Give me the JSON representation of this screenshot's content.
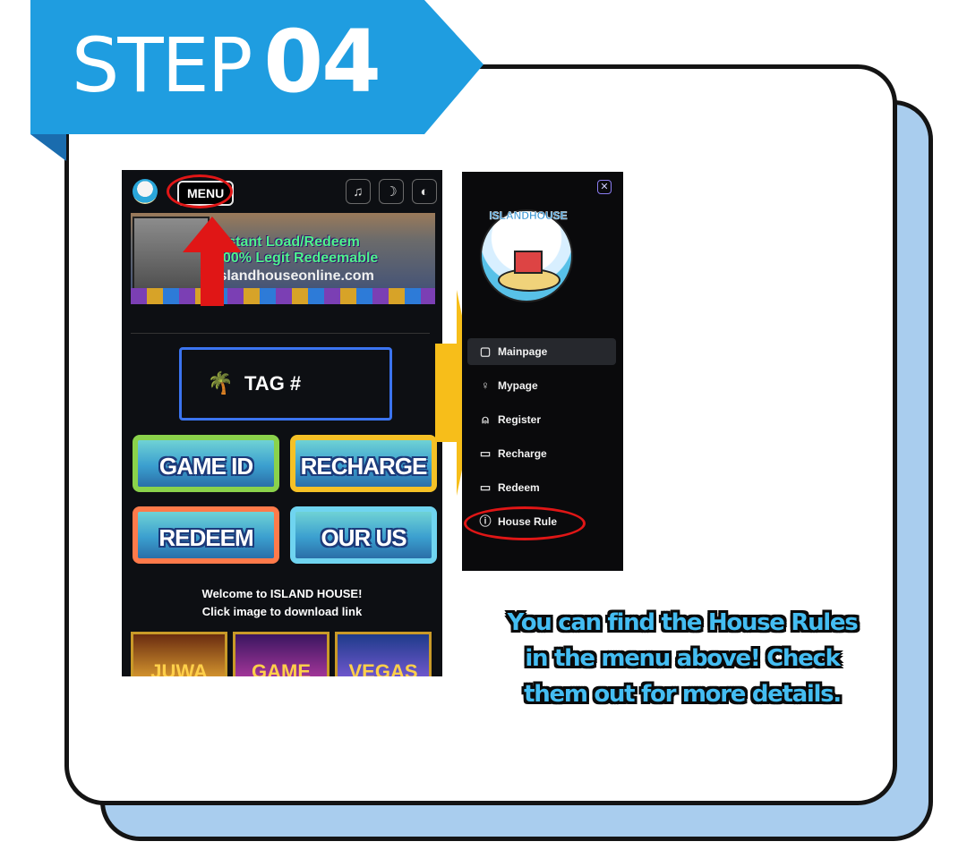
{
  "banner": {
    "step_word": "STEP",
    "step_number": "04",
    "color": "#1f9de0"
  },
  "phone": {
    "menu_button": "MENU",
    "icons": [
      "bell-icon",
      "moon-icon",
      "logout-icon"
    ],
    "promo": {
      "line1": "Instant Load/Redeem",
      "line2": "100% Legit Redeemable",
      "line3": "islandhouseonline.com"
    },
    "tag_label": "TAG #",
    "game_buttons": [
      "GAME ID",
      "RECHARGE",
      "REDEEM",
      "OUR US"
    ],
    "welcome_line1": "Welcome to ISLAND HOUSE!",
    "welcome_line2": "Click image to download link",
    "thumbs": [
      "JUWA",
      "GAME",
      "VEGAS"
    ]
  },
  "menu_panel": {
    "logo_text": "ISLANDHOUSE",
    "close_symbol": "✕",
    "items": [
      {
        "label": "Mainpage",
        "icon": "bag-icon"
      },
      {
        "label": "Mypage",
        "icon": "user-edit-icon"
      },
      {
        "label": "Register",
        "icon": "user-icon"
      },
      {
        "label": "Recharge",
        "icon": "wallet-icon"
      },
      {
        "label": "Redeem",
        "icon": "card-icon"
      },
      {
        "label": "House Rule",
        "icon": "help-circle-icon"
      }
    ]
  },
  "caption": {
    "line1": "You can find the House Rules",
    "line2": "in the menu above! Check",
    "line3": "them out for more details."
  },
  "colors": {
    "accent_red": "#e01616",
    "arrow_yellow": "#f7be1a",
    "caption_blue": "#44bdf2",
    "card_shadow": "#a9cdee"
  }
}
